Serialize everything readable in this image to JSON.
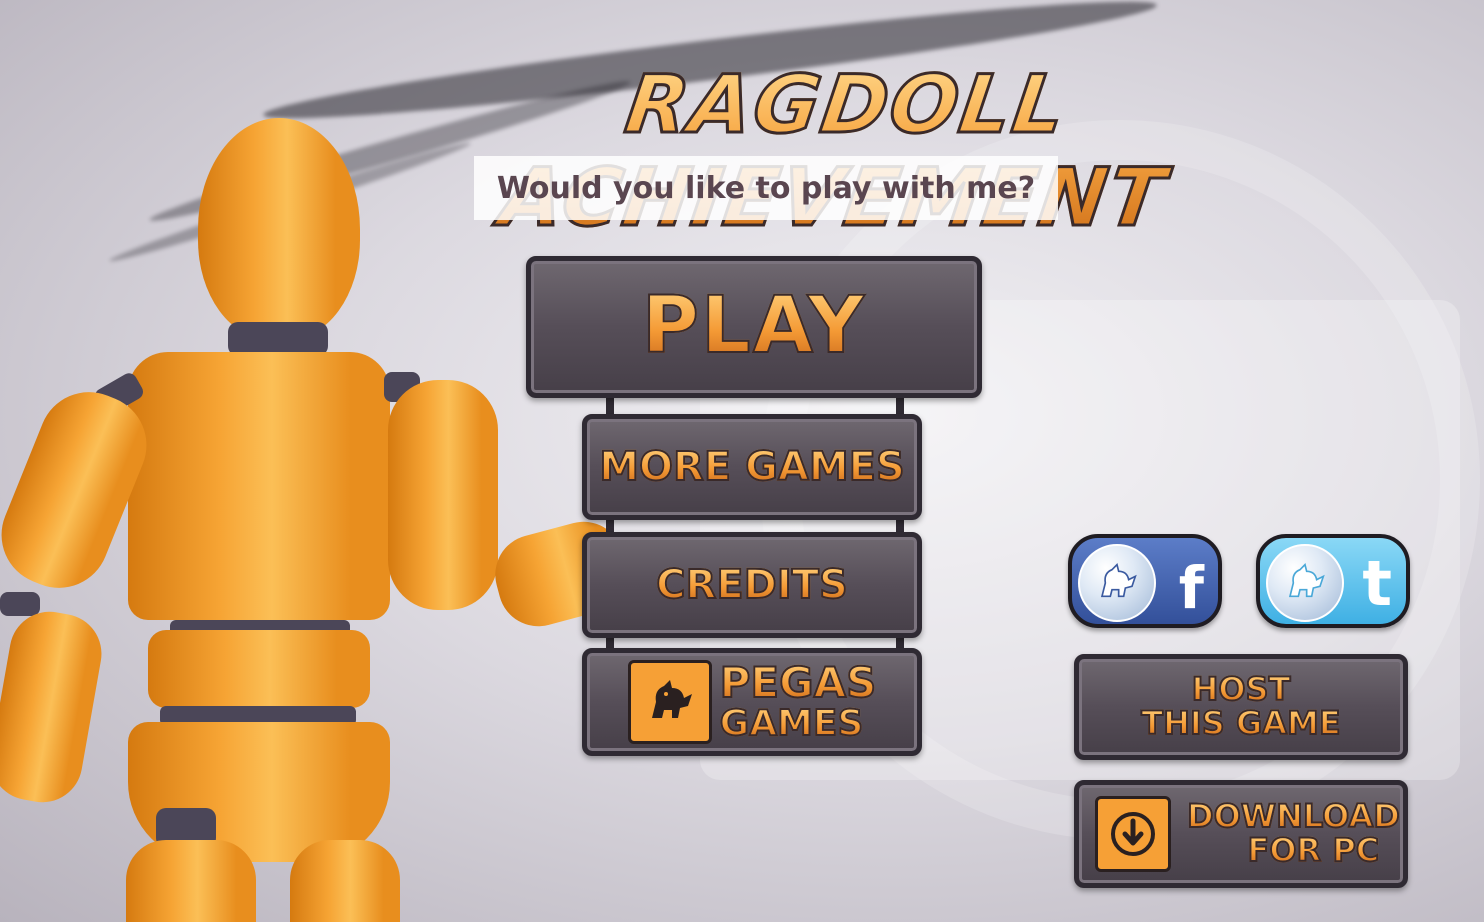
{
  "game": {
    "title": "RAGDOLL ACHIEVEMENT",
    "subtitle": "Would you like to play with me?"
  },
  "menu": {
    "play_label": "PLAY",
    "more_games_label": "MORE GAMES",
    "credits_label": "CREDITS",
    "pegas_line1": "PEGAS",
    "pegas_line2": "GAMES"
  },
  "side_menu": {
    "facebook_glyph": "f",
    "twitter_glyph": "t",
    "host_line1": "HOST",
    "host_line2": "THIS GAME",
    "download_line1": "DOWNLOAD",
    "download_line2": "FOR PC"
  },
  "icons": {
    "facebook": "facebook-icon",
    "twitter": "twitter-icon",
    "download": "download-arrow-icon",
    "mascot": "pegasus-mascot-icon"
  },
  "colors": {
    "accent_orange": "#f49a35",
    "button_dark": "#564e58",
    "facebook_blue": "#3b5aa8",
    "twitter_blue": "#4fb9e8"
  }
}
